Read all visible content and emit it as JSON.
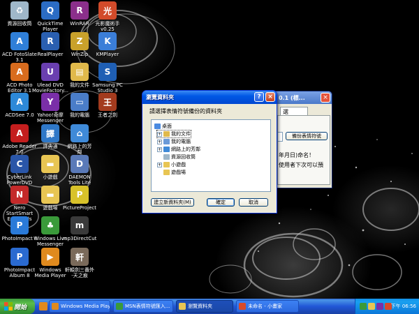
{
  "desktop": {
    "icons": [
      {
        "label": "資源回收筒",
        "icon": "recycle-bin-icon",
        "color": "#9fb7c9",
        "glyph": "♻"
      },
      {
        "label": "QuickTime\nPlayer",
        "icon": "quicktime-icon",
        "color": "#2b6cc4",
        "glyph": "Q"
      },
      {
        "label": "WinRAR",
        "icon": "winrar-icon",
        "color": "#8b2f8b",
        "glyph": "R"
      },
      {
        "label": "光影魔術手\nv0.25",
        "icon": "photo-magic-icon",
        "color": "#d24b2a",
        "glyph": "光"
      },
      {
        "label": "ACD FotoSlate\n3.1",
        "icon": "acd-fotoslate-icon",
        "color": "#2f7fd8",
        "glyph": "A"
      },
      {
        "label": "RealPlayer",
        "icon": "realplayer-icon",
        "color": "#2a5fb0",
        "glyph": "R"
      },
      {
        "label": "WinZip",
        "icon": "winzip-icon",
        "color": "#c9a12b",
        "glyph": "Z"
      },
      {
        "label": "KMPlayer",
        "icon": "kmplayer-icon",
        "color": "#3b7ed8",
        "glyph": "K"
      },
      {
        "label": "ACD Photo\nEditor 3.1",
        "icon": "acd-photo-editor-icon",
        "color": "#d86c1e",
        "glyph": "A"
      },
      {
        "label": "Ulead DVD\nMovieFactory...",
        "icon": "ulead-dvd-icon",
        "color": "#6a3fb0",
        "glyph": "U"
      },
      {
        "label": "我的文件",
        "icon": "my-documents-icon",
        "color": "#e0b94b",
        "glyph": "▤"
      },
      {
        "label": "Samsung PC\nStudio 3",
        "icon": "samsung-pc-studio-icon",
        "color": "#1f5fb4",
        "glyph": "S"
      },
      {
        "label": "ACDSee 7.0",
        "icon": "acdsee-icon",
        "color": "#2d89d8",
        "glyph": "A"
      },
      {
        "label": "Yahoo!奇摩\nMessenger",
        "icon": "yahoo-messenger-icon",
        "color": "#7a2fa8",
        "glyph": "Y"
      },
      {
        "label": "我的電腦",
        "icon": "my-computer-icon",
        "color": "#4a7dc8",
        "glyph": "▭"
      },
      {
        "label": "王者之劍",
        "icon": "game-sword-icon",
        "color": "#a33b1e",
        "glyph": "王"
      },
      {
        "label": "Adobe Reader\n7.0",
        "icon": "adobe-reader-icon",
        "color": "#c41e1e",
        "glyph": "A"
      },
      {
        "label": "譯典通",
        "icon": "dictionary-icon",
        "color": "#2f78c8",
        "glyph": "譯"
      },
      {
        "label": "網路上的芳\n鄰",
        "icon": "network-places-icon",
        "color": "#3f8ad8",
        "glyph": "⌂"
      },
      {
        "label": "",
        "icon": "none",
        "color": "",
        "glyph": ""
      },
      {
        "label": "CyberLink\nPowerDVD",
        "icon": "powerdvd-icon",
        "color": "#2a56a8",
        "glyph": "C"
      },
      {
        "label": "小遊戲",
        "icon": "folder-icon",
        "color": "#e8c553",
        "glyph": "▬"
      },
      {
        "label": "DAEMON\nTools Lite",
        "icon": "daemon-tools-icon",
        "color": "#5a7ab8",
        "glyph": "D"
      },
      {
        "label": "",
        "icon": "none",
        "color": "",
        "glyph": ""
      },
      {
        "label": "Nero StartSmart\nEssentials",
        "icon": "nero-icon",
        "color": "#c42a2a",
        "glyph": "N"
      },
      {
        "label": "遊戲場",
        "icon": "folder-icon",
        "color": "#e8c553",
        "glyph": "▬"
      },
      {
        "label": "PictureProject",
        "icon": "pictureproject-icon",
        "color": "#d8c22a",
        "glyph": "P"
      },
      {
        "label": "",
        "icon": "none",
        "color": "",
        "glyph": ""
      },
      {
        "label": "PhotoImpact 8",
        "icon": "photoimpact-icon",
        "color": "#2a7ad8",
        "glyph": "P"
      },
      {
        "label": "Windows Live\nMessenger",
        "icon": "live-messenger-icon",
        "color": "#3a9a3a",
        "glyph": "♣"
      },
      {
        "label": "mp3DirectCut",
        "icon": "mp3directcut-icon",
        "color": "#3a3a3a",
        "glyph": "m"
      },
      {
        "label": "",
        "icon": "none",
        "color": "",
        "glyph": ""
      },
      {
        "label": "PhotoImpact\nAlbum 8",
        "icon": "photoimpact-album-icon",
        "color": "#2a6ad0",
        "glyph": "P"
      },
      {
        "label": "Windows\nMedia Player",
        "icon": "media-player-icon",
        "color": "#e08a1e",
        "glyph": "▶"
      },
      {
        "label": "軒轅劍三番外\n-天之痕",
        "icon": "game-xuanyuan-icon",
        "color": "#7a6a5a",
        "glyph": "軒"
      }
    ]
  },
  "background_window": {
    "title": "0.1 (標...",
    "tab_label": "選",
    "button_label": "備份表情符號",
    "line1": "年月日)命名！",
    "line2": "使用者下次可以預"
  },
  "dialog": {
    "title": "瀏覽資料夾",
    "prompt": "請選擇表情符號備份的資料夾",
    "help_glyph": "?",
    "close_glyph": "×",
    "tree": [
      {
        "label": "桌面",
        "icon": "desktop-icon",
        "expander": "",
        "indent": 0,
        "color": "#4a8ae0"
      },
      {
        "label": "我的文件",
        "icon": "my-documents-icon",
        "expander": "+",
        "indent": 1,
        "color": "#e0b94b",
        "selected": true
      },
      {
        "label": "我的電腦",
        "icon": "my-computer-icon",
        "expander": "+",
        "indent": 1,
        "color": "#6a9ad8"
      },
      {
        "label": "網路上的芳鄰",
        "icon": "network-places-icon",
        "expander": "+",
        "indent": 1,
        "color": "#3f8ad8"
      },
      {
        "label": "資源回收筒",
        "icon": "recycle-bin-icon",
        "expander": "",
        "indent": 1,
        "color": "#9fb7c9"
      },
      {
        "label": "小遊戲",
        "icon": "folder-icon",
        "expander": "+",
        "indent": 1,
        "color": "#e8c553"
      },
      {
        "label": "遊戲場",
        "icon": "folder-icon",
        "expander": "",
        "indent": 1,
        "color": "#e8c553"
      }
    ],
    "new_folder_label": "建立新資料夾(M)",
    "ok_label": "確定",
    "cancel_label": "取消"
  },
  "taskbar": {
    "start_label": "開始",
    "tasks": [
      {
        "label": "Windows Media Player",
        "icon": "media-player-icon",
        "color": "#e08a1e",
        "active": false
      },
      {
        "label": "MSN表情符號匯入...",
        "icon": "msn-icon",
        "color": "#3a9a3a",
        "active": false
      },
      {
        "label": "瀏覽資料夾",
        "icon": "folder-browse-icon",
        "color": "#e8c553",
        "active": true
      },
      {
        "label": "未命名 - 小畫家",
        "icon": "paint-icon",
        "color": "#d84a2a",
        "active": false
      }
    ],
    "clock": "下午 06:56"
  }
}
